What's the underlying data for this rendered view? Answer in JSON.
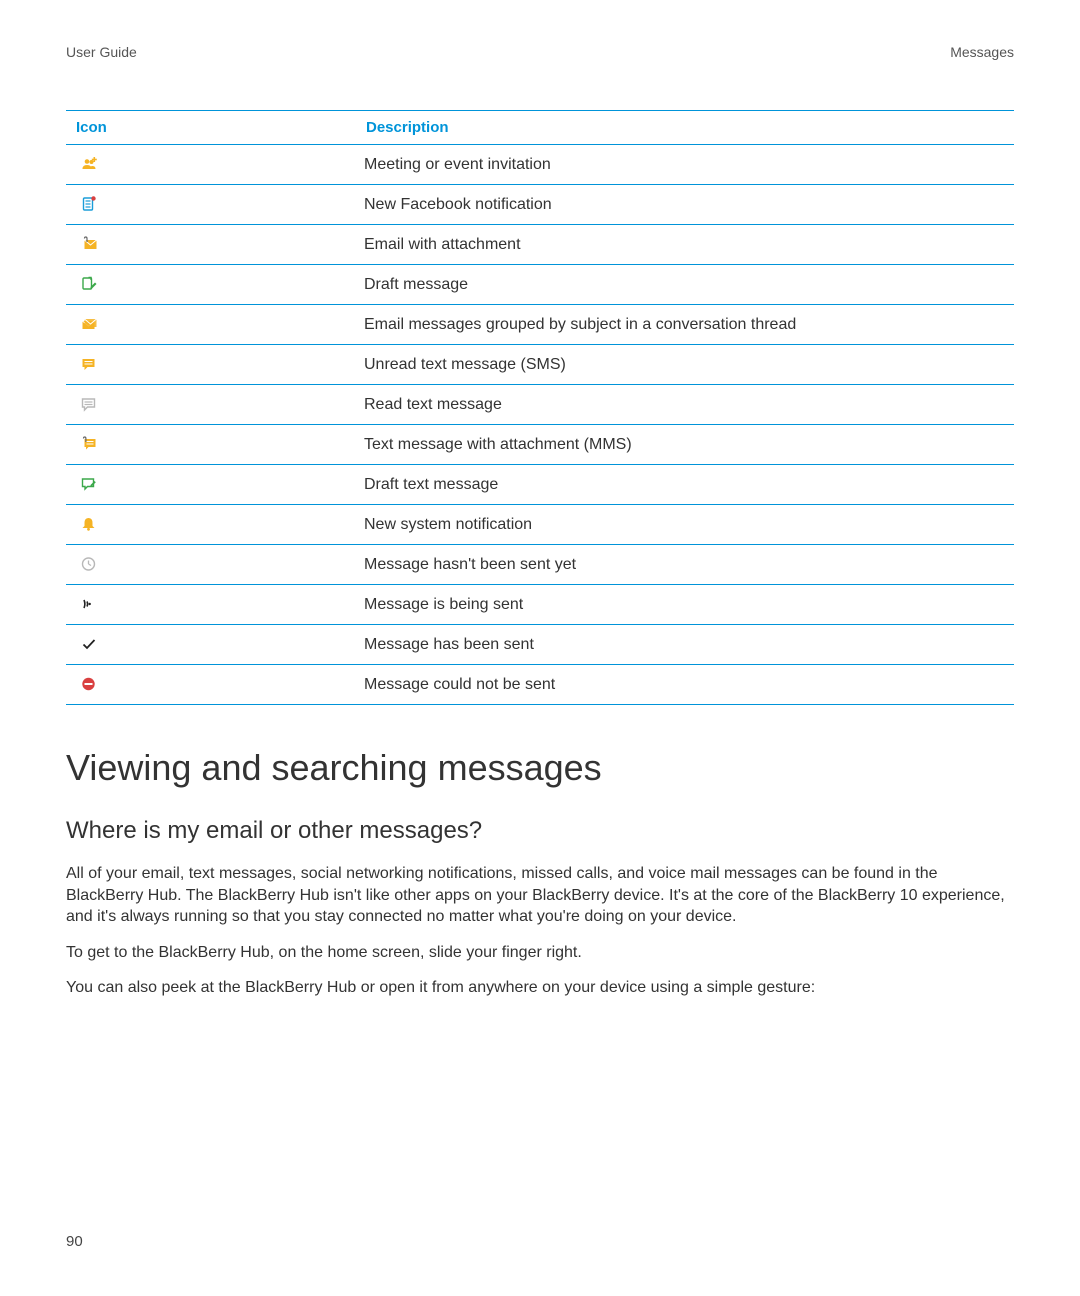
{
  "header": {
    "left": "User Guide",
    "right": "Messages"
  },
  "table": {
    "headers": {
      "icon": "Icon",
      "description": "Description"
    },
    "rows": [
      {
        "icon": "people-plus-icon",
        "desc": "Meeting or event invitation"
      },
      {
        "icon": "notification-doc-icon",
        "desc": "New Facebook notification"
      },
      {
        "icon": "envelope-clip-icon",
        "desc": "Email with attachment"
      },
      {
        "icon": "draft-compose-icon",
        "desc": "Draft message"
      },
      {
        "icon": "envelope-stack-icon",
        "desc": "Email messages grouped by subject in a conversation thread"
      },
      {
        "icon": "chat-filled-icon",
        "desc": "Unread text message (SMS)"
      },
      {
        "icon": "chat-outline-icon",
        "desc": "Read text message"
      },
      {
        "icon": "chat-clip-icon",
        "desc": "Text message with attachment (MMS)"
      },
      {
        "icon": "chat-draft-icon",
        "desc": "Draft text message"
      },
      {
        "icon": "bell-icon",
        "desc": "New system notification"
      },
      {
        "icon": "clock-icon",
        "desc": "Message hasn't been sent yet"
      },
      {
        "icon": "sending-icon",
        "desc": "Message is being sent"
      },
      {
        "icon": "checkmark-icon",
        "desc": "Message has been sent"
      },
      {
        "icon": "error-circle-icon",
        "desc": "Message could not be sent"
      }
    ]
  },
  "section": {
    "title": "Viewing and searching messages",
    "subtitle": "Where is my email or other messages?",
    "paragraphs": [
      "All of your email, text messages, social networking notifications, missed calls, and voice mail messages can be found in the BlackBerry Hub. The BlackBerry Hub isn't like other apps on your BlackBerry device. It's at the core of the BlackBerry 10 experience, and it's always running so that you stay connected no matter what you're doing on your device.",
      "To get to the BlackBerry Hub, on the home screen, slide your finger right.",
      "You can also peek at the BlackBerry Hub or open it from anywhere on your device using a simple gesture:"
    ]
  },
  "page_number": "90"
}
